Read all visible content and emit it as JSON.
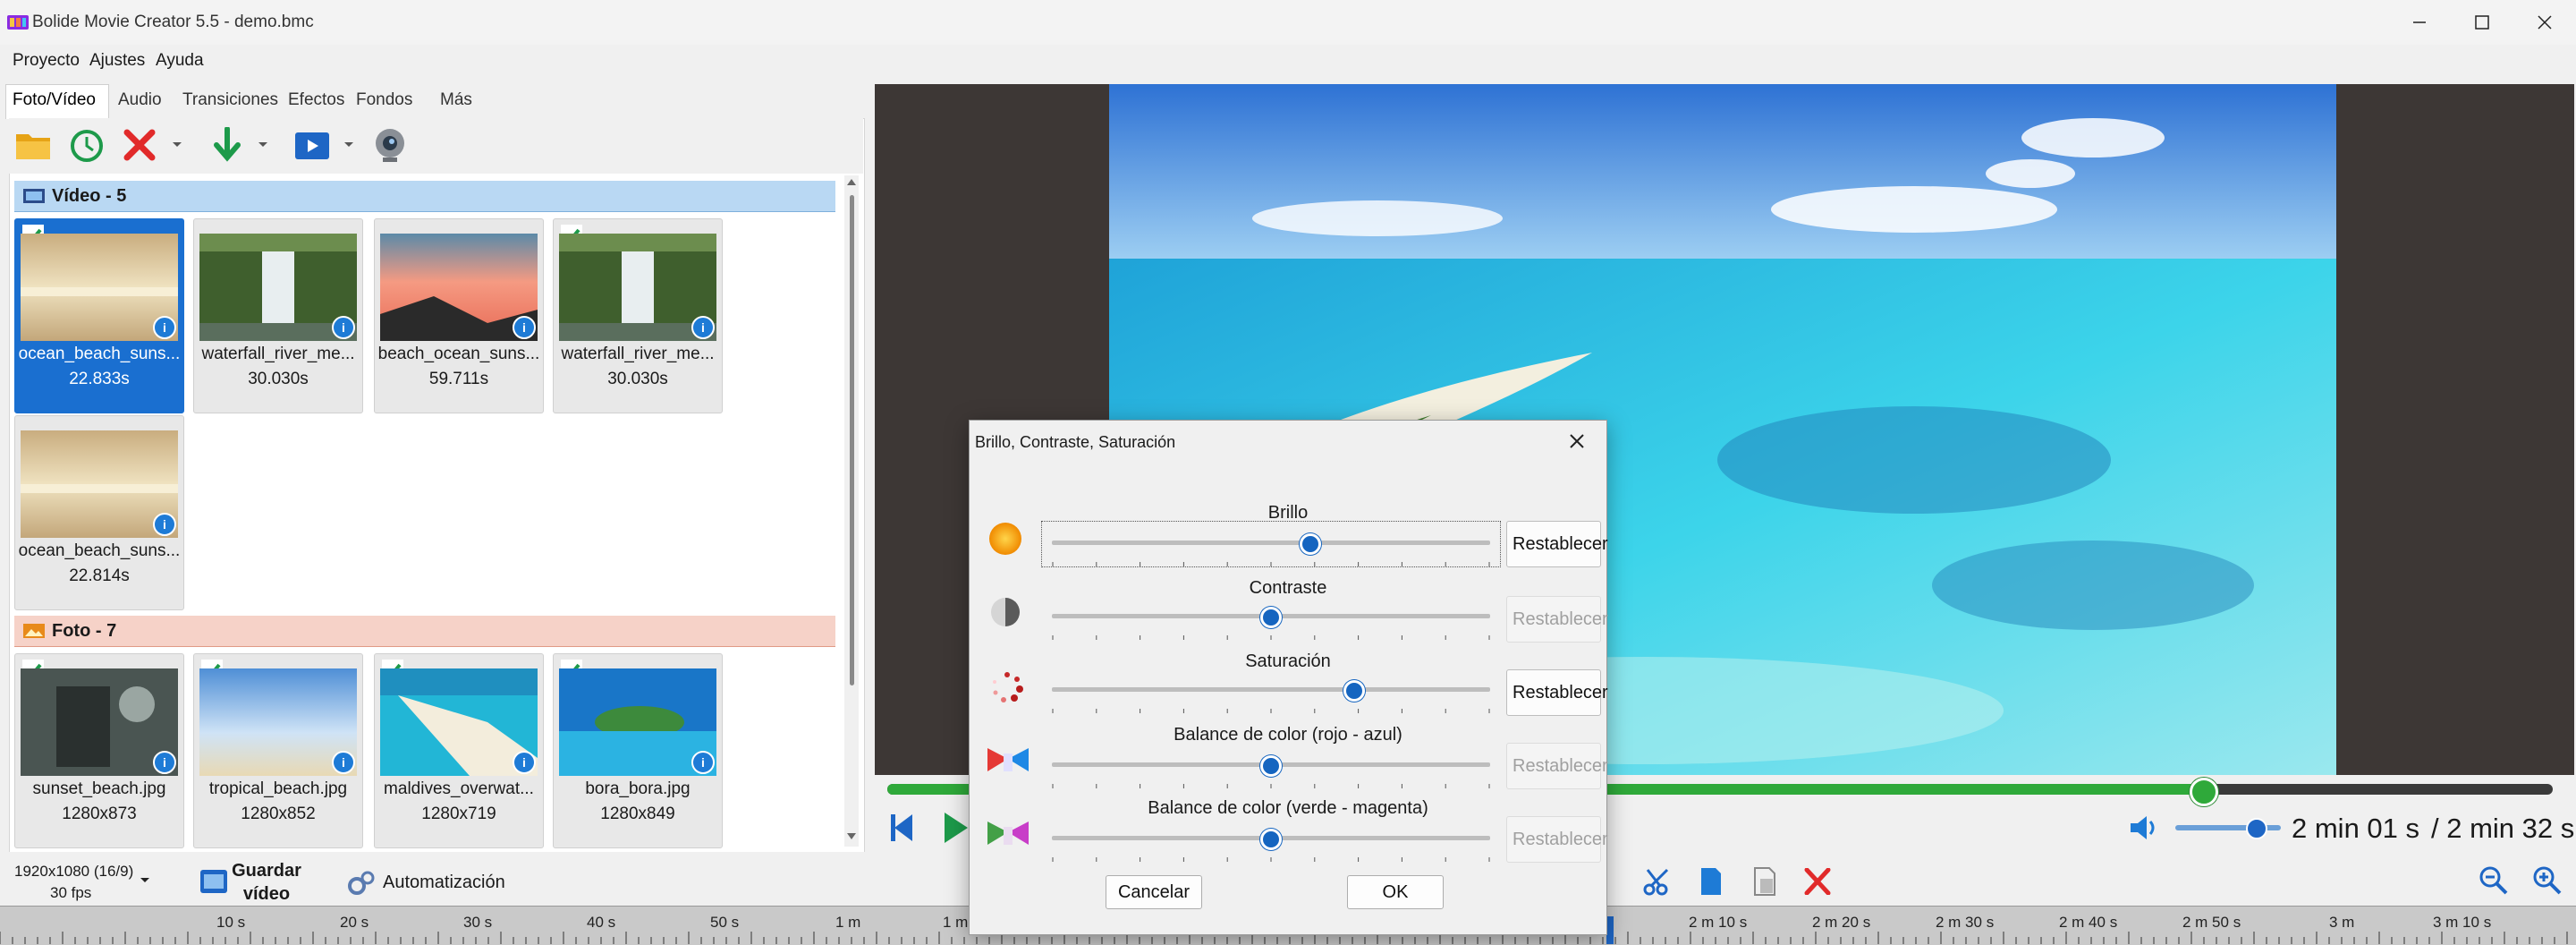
{
  "window": {
    "title": "Bolide Movie Creator 5.5 - demo.bmc"
  },
  "menu": [
    "Proyecto",
    "Ajustes",
    "Ayuda"
  ],
  "tabs": [
    "Foto/Vídeo",
    "Audio",
    "Transiciones",
    "Efectos",
    "Fondos",
    "Más"
  ],
  "groups": {
    "video": {
      "label": "Vídeo - 5",
      "items": [
        {
          "name": "ocean_beach_suns...",
          "sub": "22.833s",
          "checked": true,
          "selected": true
        },
        {
          "name": "waterfall_river_me...",
          "sub": "30.030s",
          "checked": false
        },
        {
          "name": "beach_ocean_suns...",
          "sub": "59.711s",
          "checked": false
        },
        {
          "name": "waterfall_river_me...",
          "sub": "30.030s",
          "checked": true
        },
        {
          "name": "ocean_beach_suns...",
          "sub": "22.814s",
          "checked": false
        }
      ]
    },
    "photo": {
      "label": "Foto - 7",
      "items": [
        {
          "name": "sunset_beach.jpg",
          "sub": "1280x873",
          "checked": true
        },
        {
          "name": "tropical_beach.jpg",
          "sub": "1280x852",
          "checked": true
        },
        {
          "name": "maldives_overwat...",
          "sub": "1280x719",
          "checked": true
        },
        {
          "name": "bora_bora.jpg",
          "sub": "1280x849",
          "checked": true
        }
      ]
    }
  },
  "bottom": {
    "resolution": "1920x1080 (16/9)",
    "fps": "30 fps",
    "save_line1": "Guardar",
    "save_line2": "vídeo",
    "automation": "Automatización"
  },
  "player": {
    "current_time": "2 min 01 s",
    "total_time": "/ 2 min 32 s",
    "progress": 0.79,
    "volume": 0.75
  },
  "ruler_labels": [
    "10 s",
    "20 s",
    "30 s",
    "40 s",
    "50 s",
    "1 m",
    "1 m",
    "2 m 10 s",
    "2 m 20 s",
    "2 m 30 s",
    "2 m 40 s",
    "2 m 50 s",
    "3 m",
    "3 m 10 s"
  ],
  "dialog": {
    "title": "Brillo, Contraste, Saturación",
    "rows": [
      {
        "label": "Brillo",
        "value": 0.59,
        "reset": "Restablecer",
        "enabled": true
      },
      {
        "label": "Contraste",
        "value": 0.5,
        "reset": "Restablecer",
        "enabled": false
      },
      {
        "label": "Saturación",
        "value": 0.69,
        "reset": "Restablecer",
        "enabled": true
      },
      {
        "label": "Balance de color (rojo - azul)",
        "value": 0.5,
        "reset": "Restablecer",
        "enabled": false
      },
      {
        "label": "Balance de color (verde - magenta)",
        "value": 0.5,
        "reset": "Restablecer",
        "enabled": false
      }
    ],
    "cancel": "Cancelar",
    "ok": "OK"
  },
  "colors": {
    "accent": "#1a6fd0",
    "progress": "#2fa93a",
    "video_header": "#b9d8f3",
    "photo_header": "#f6d2c8"
  }
}
